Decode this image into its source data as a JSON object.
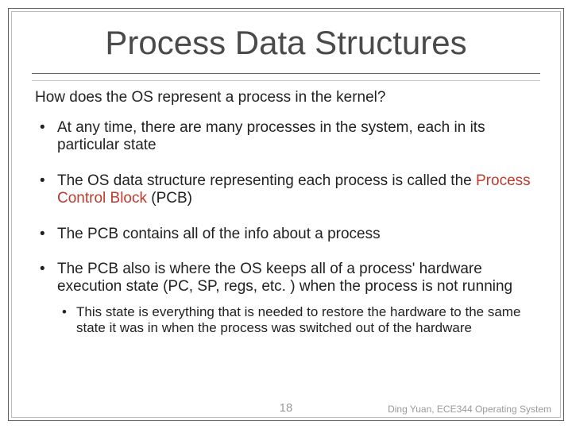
{
  "title": "Process Data Structures",
  "lead": "How does the OS represent a process in the kernel?",
  "bullets": [
    {
      "text": "At any time, there are many processes in the system, each in its particular state"
    },
    {
      "prefix": "The OS data structure representing each process is called the ",
      "accent": "Process Control Block",
      "suffix": " (PCB)"
    },
    {
      "text": "The PCB contains all of the info about a process"
    },
    {
      "text": "The PCB also is where the OS keeps all of a process' hardware execution state (PC, SP, regs, etc. ) when the process is not running",
      "sub": "This state is everything that is needed to restore the hardware to the same state it was in when the process was switched out of the hardware"
    }
  ],
  "page_number": "18",
  "footer": "Ding Yuan, ECE344 Operating System"
}
